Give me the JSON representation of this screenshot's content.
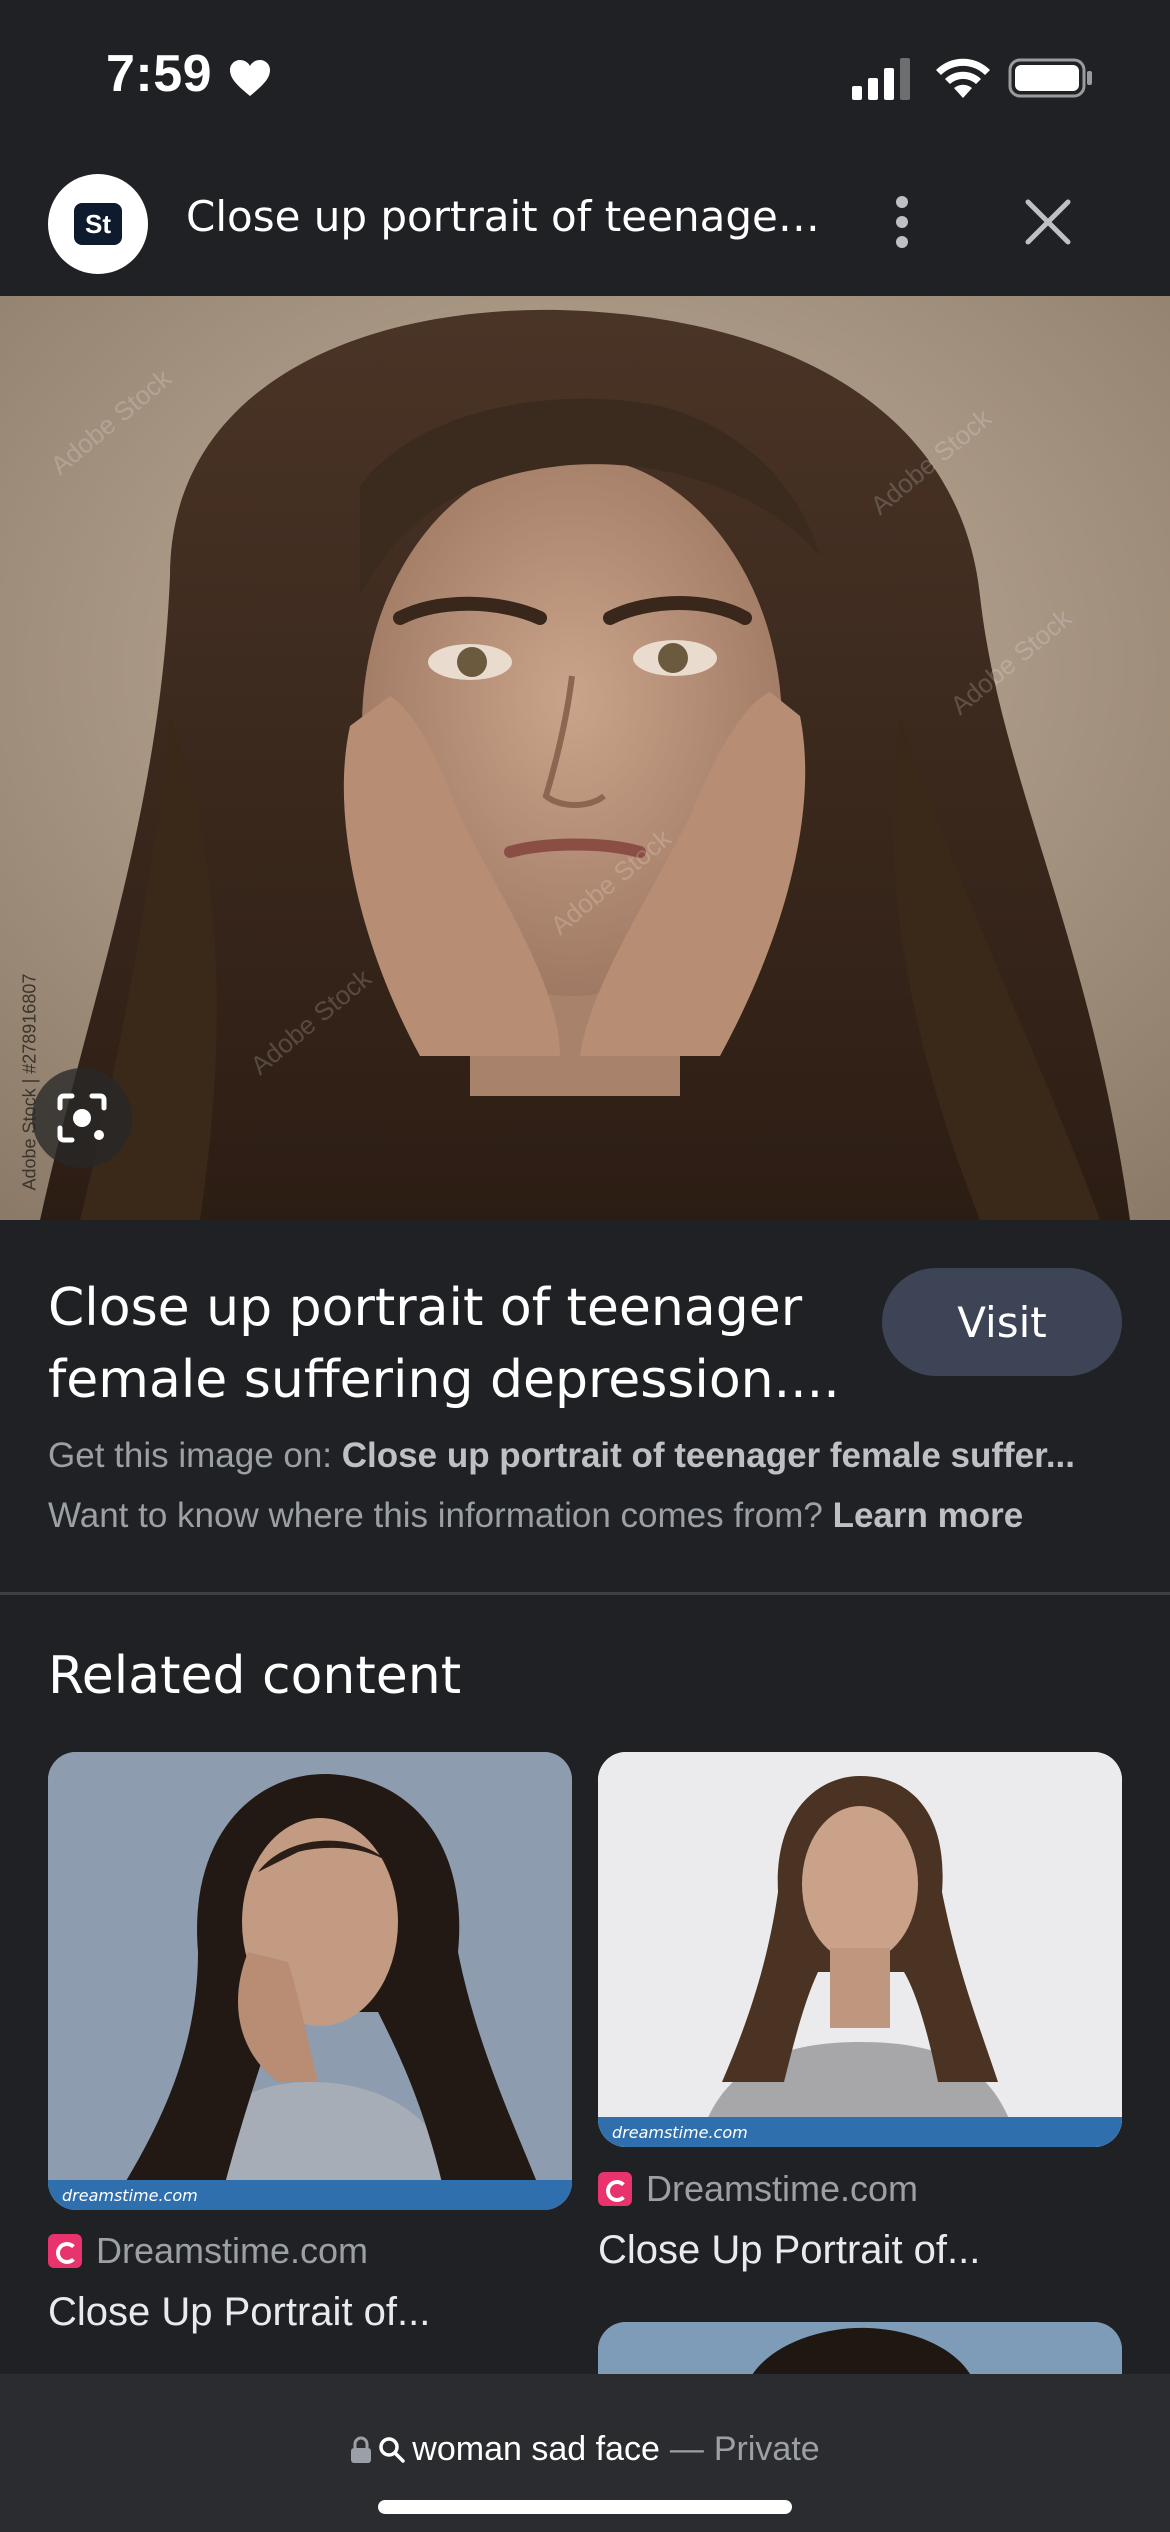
{
  "status_bar": {
    "time": "7:59"
  },
  "header": {
    "source_logo_text": "St",
    "title": "Close up portrait of teenager f..."
  },
  "main_image": {
    "credit_text": "Adobe Stock | #278916807"
  },
  "info": {
    "title": "Close up portrait of teenager female suffering depression....",
    "visit_label": "Visit",
    "get_image_prefix": "Get this image on:",
    "get_image_source": "Close up portrait of teenager female suffer...",
    "info_question": "Want to know where this information comes from?",
    "learn_more": "Learn more"
  },
  "related": {
    "heading": "Related content",
    "items": [
      {
        "source": "Dreamstime.com",
        "caption": "Close Up Portrait of...",
        "watermark": "dreamstime.com"
      },
      {
        "source": "Dreamstime.com",
        "caption": "Close Up Portrait of...",
        "watermark": "dreamstime.com"
      }
    ]
  },
  "bottom_bar": {
    "query": "woman sad face",
    "separator": "—",
    "mode": "Private"
  },
  "colors": {
    "background": "#202124",
    "visit_button": "#3c4455",
    "favicon": "#e8336d"
  }
}
